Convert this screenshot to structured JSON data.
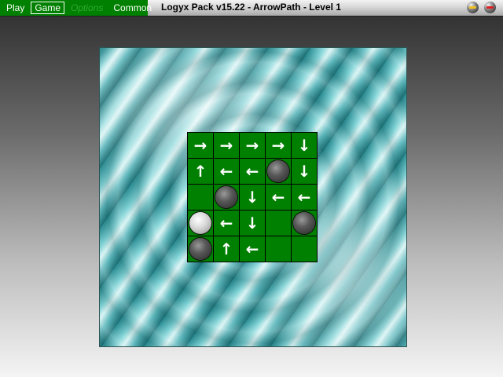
{
  "menu": {
    "items": [
      {
        "label": "Play",
        "state": "normal"
      },
      {
        "label": "Game",
        "state": "active"
      },
      {
        "label": "Options",
        "state": "disabled"
      },
      {
        "label": "Common",
        "state": "normal"
      }
    ]
  },
  "window": {
    "title": "Logyx Pack v15.22 - ArrowPath - Level 1",
    "buttons": [
      "minimize-icon",
      "close-icon"
    ]
  },
  "colors": {
    "board_green": "#008000",
    "grid_line": "#000000",
    "arrow": "#ffffff"
  },
  "board": {
    "rows": 5,
    "cols": 5,
    "cells": [
      [
        "right",
        "right",
        "right",
        "right",
        "down"
      ],
      [
        "up",
        "left",
        "left",
        "ball-dark",
        "down"
      ],
      [
        "empty",
        "ball-dark",
        "down",
        "left",
        "left"
      ],
      [
        "ball-light",
        "left",
        "down",
        "empty",
        "ball-dark"
      ],
      [
        "ball-dark",
        "up",
        "left",
        "empty",
        "empty"
      ]
    ]
  }
}
